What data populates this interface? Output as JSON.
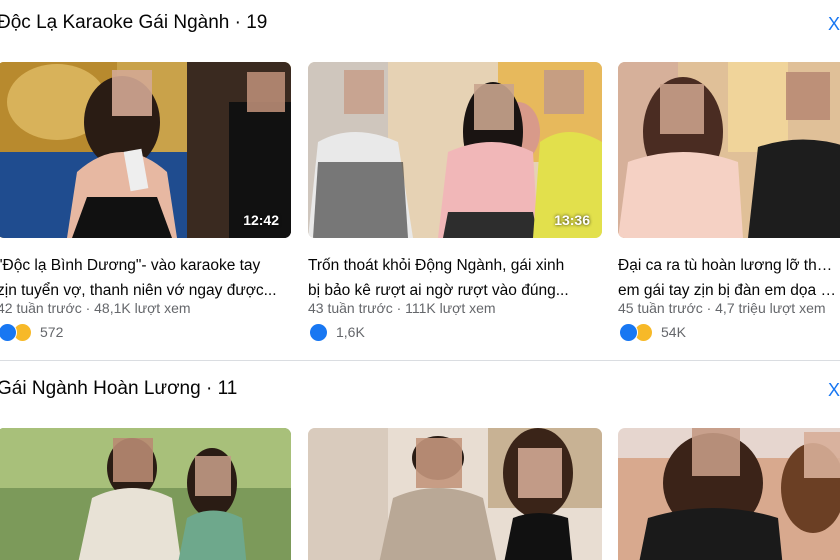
{
  "sections": [
    {
      "title": "Độc Lạ Karaoke Gái Ngành · 19",
      "see_all": "Xem",
      "videos": [
        {
          "duration": "12:42",
          "title_line1": "\"Độc lạ Bình Dương\"- vào karaoke tay",
          "title_line2": "zịn tuyển vợ, thanh niên vớ ngay được...",
          "meta": "42 tuần trước · 48,1K lượt xem",
          "reactions": "572",
          "reaction_icons": [
            "like-icon",
            "haha-icon"
          ]
        },
        {
          "duration": "13:36",
          "title_line1": "Trốn thoát khỏi Động Ngành, gái xinh",
          "title_line2": "bị bảo kê rượt ai ngờ rượt vào đúng...",
          "meta": "43 tuần trước · 111K lượt xem",
          "reactions": "1,6K",
          "reaction_icons": [
            "like-icon"
          ]
        },
        {
          "duration": "",
          "title_line1": "Đại ca ra tù hoàn lương lỡ thương",
          "title_line2": "em gái tay zịn bị đàn em dọa giết",
          "meta": "45 tuần trước · 4,7 triệu lượt xem",
          "reactions": "54K",
          "reaction_icons": [
            "like-icon",
            "haha-icon"
          ]
        }
      ]
    },
    {
      "title": "Gái Ngành Hoàn Lương · 11",
      "see_all": "Xem"
    }
  ],
  "colors": {
    "accent": "#1877f2",
    "secondary_text": "#65676b",
    "divider": "#dadde1",
    "haha": "#f7b928"
  }
}
